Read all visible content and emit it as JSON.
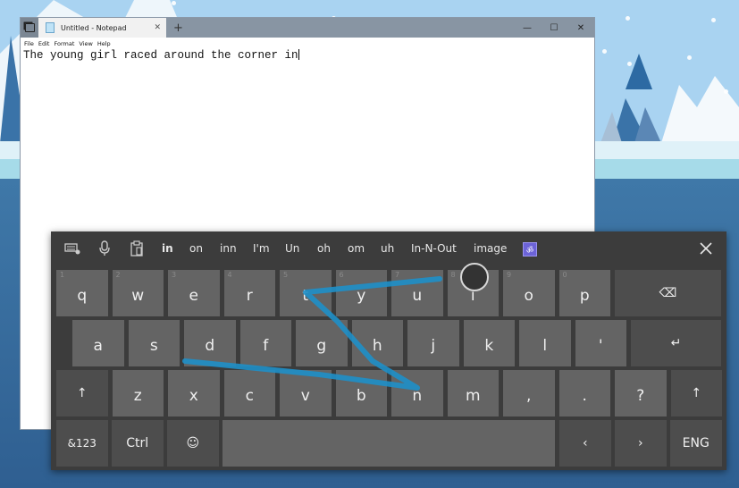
{
  "notepad": {
    "tab_title": "Untitled - Notepad",
    "tab_close": "✕",
    "new_tab": "+",
    "minimize": "—",
    "maximize": "☐",
    "close": "✕",
    "menu": [
      "File",
      "Edit",
      "Format",
      "View",
      "Help"
    ],
    "text": "The young girl raced around the corner in"
  },
  "keyboard": {
    "toolbar_icons": [
      "keyboard-settings-icon",
      "microphone-icon",
      "clipboard-icon"
    ],
    "suggestions": [
      "in",
      "on",
      "inn",
      "I'm",
      "Un",
      "oh",
      "om",
      "uh",
      "In-N-Out",
      "image"
    ],
    "selected_suggestion": "in",
    "emoji_suggestion": "ॐ",
    "close": "✕",
    "accent_trace_color": "#1e8fc8",
    "rows": [
      [
        {
          "k": "q",
          "h": "1"
        },
        {
          "k": "w",
          "h": "2"
        },
        {
          "k": "e",
          "h": "3"
        },
        {
          "k": "r",
          "h": "4"
        },
        {
          "k": "t",
          "h": "5"
        },
        {
          "k": "y",
          "h": "6"
        },
        {
          "k": "u",
          "h": "7"
        },
        {
          "k": "i",
          "h": "8"
        },
        {
          "k": "o",
          "h": "9"
        },
        {
          "k": "p",
          "h": "0"
        },
        {
          "k": "⌫",
          "h": ""
        }
      ],
      [
        {
          "k": "a"
        },
        {
          "k": "s"
        },
        {
          "k": "d"
        },
        {
          "k": "f"
        },
        {
          "k": "g"
        },
        {
          "k": "h"
        },
        {
          "k": "j"
        },
        {
          "k": "k"
        },
        {
          "k": "l"
        },
        {
          "k": "'"
        },
        {
          "k": "↵"
        }
      ],
      [
        {
          "k": "↑"
        },
        {
          "k": "z"
        },
        {
          "k": "x"
        },
        {
          "k": "c"
        },
        {
          "k": "v"
        },
        {
          "k": "b"
        },
        {
          "k": "n"
        },
        {
          "k": "m"
        },
        {
          "k": ","
        },
        {
          "k": "."
        },
        {
          "k": "?"
        },
        {
          "k": "↑"
        }
      ],
      [
        {
          "k": "&123"
        },
        {
          "k": "Ctrl"
        },
        {
          "k": "☺"
        },
        {
          "k": ""
        },
        {
          "k": "‹"
        },
        {
          "k": "›"
        },
        {
          "k": "ENG"
        }
      ]
    ]
  }
}
